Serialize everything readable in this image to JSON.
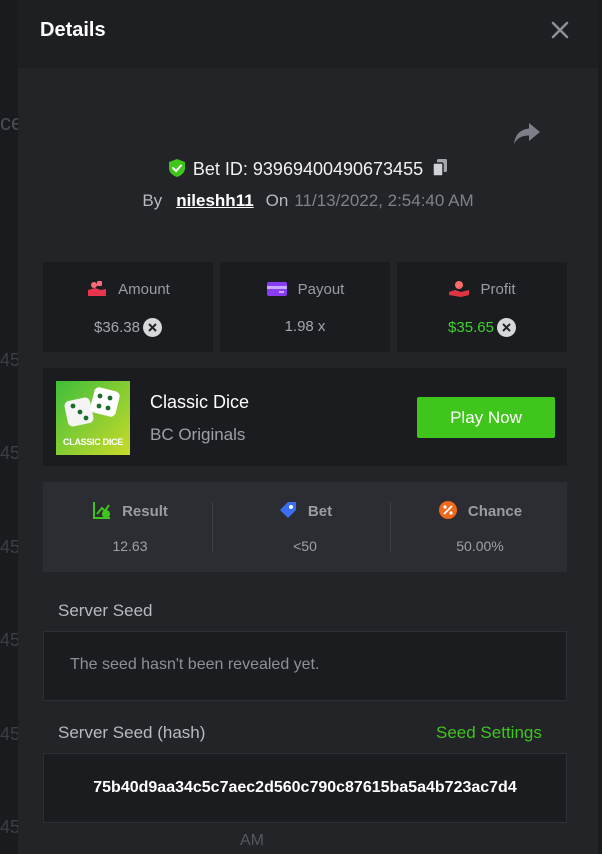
{
  "background": {
    "fragments": [
      "ce",
      "45",
      "45",
      "45",
      "45",
      "45",
      "45",
      "AM"
    ]
  },
  "modal": {
    "title": "Details",
    "bet_id_label": "Bet ID: 93969400490673455",
    "by_label": "By",
    "username": "nileshh11",
    "on_label": "On",
    "datetime": "11/13/2022, 2:54:40 AM",
    "stats": [
      {
        "label": "Amount",
        "value": "$36.38",
        "icon": "amount-icon",
        "color": "#e8344f"
      },
      {
        "label": "Payout",
        "value": "1.98 x",
        "icon": "payout-icon",
        "color": "#8a3cf0"
      },
      {
        "label": "Profit",
        "value": "$35.65",
        "icon": "profit-icon",
        "color": "#e03540"
      }
    ],
    "game": {
      "name": "Classic Dice",
      "provider": "BC Originals",
      "thumb_text": "CLASSIC DICE",
      "play_label": "Play Now"
    },
    "results": [
      {
        "label": "Result",
        "value": "12.63",
        "icon": "result-icon",
        "color": "#3fc51c"
      },
      {
        "label": "Bet",
        "value": "<50",
        "icon": "bet-icon",
        "color": "#3a6df0"
      },
      {
        "label": "Chance",
        "value": "50.00%",
        "icon": "chance-icon",
        "color": "#ee6a1b"
      }
    ],
    "server_seed_label": "Server Seed",
    "server_seed_text": "The seed hasn't been revealed yet.",
    "server_seed_hash_label": "Server Seed (hash)",
    "seed_settings_label": "Seed Settings",
    "server_seed_hash": "75b40d9aa34c5c7aec2d560c790c87615ba5a4b723ac7d4"
  },
  "colors": {
    "accent": "#3fc51c",
    "modal_bg": "#232428",
    "card_bg": "#1b1c20"
  }
}
